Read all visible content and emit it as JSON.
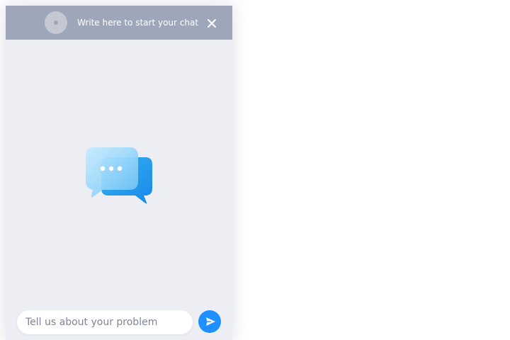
{
  "chat": {
    "header": {
      "title": "Write here to start your chat",
      "avatar_icon": "avatar-placeholder-icon",
      "close_icon": "close-icon"
    },
    "body": {
      "illustration_icon": "chat-bubbles-icon"
    },
    "composer": {
      "placeholder": "Tell us about your problem",
      "value": "",
      "send_icon": "send-arrow-icon"
    },
    "colors": {
      "header_bg": "#9ea7b9",
      "panel_bg": "#eceef3",
      "accent": "#1e90ff"
    }
  }
}
